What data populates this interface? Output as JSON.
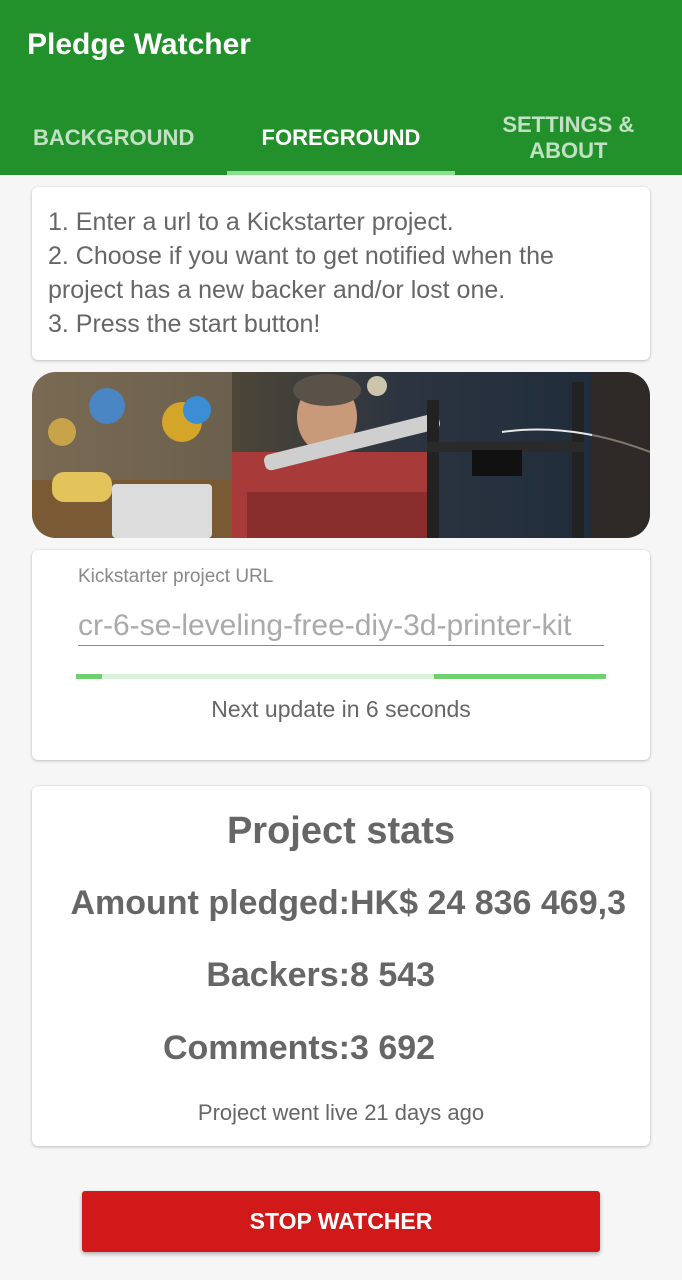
{
  "app": {
    "title": "Pledge Watcher"
  },
  "tabs": [
    {
      "label": "BACKGROUND",
      "active": false
    },
    {
      "label": "FOREGROUND",
      "active": true
    },
    {
      "label": "SETTINGS & ABOUT",
      "active": false
    }
  ],
  "instructions": {
    "line1": "1. Enter a url to a Kickstarter project.",
    "line2": "2. Choose if you want to get notified when the project has a new backer and/or lost one.",
    "line3": "3. Press the start button!"
  },
  "banner": {
    "icon": "project-banner-image"
  },
  "url": {
    "label": "Kickstarter project URL",
    "value": "cr-6-se-leveling-free-diy-3d-printer-kit"
  },
  "update": {
    "text": "Next update in 6 seconds",
    "progress": 0.7
  },
  "stats": {
    "title": "Project stats",
    "pledged_label": "Amount pledged:",
    "pledged_value": "HK$ 24 836 469,3",
    "backers_label": "Backers:",
    "backers_value": "8 543",
    "comments_label": "Comments:",
    "comments_value": "3 692",
    "live": "Project went live 21 days ago"
  },
  "actions": {
    "stop_label": "STOP WATCHER"
  },
  "colors": {
    "primary": "#23912b",
    "accent": "#8be08f",
    "danger": "#d11919"
  }
}
